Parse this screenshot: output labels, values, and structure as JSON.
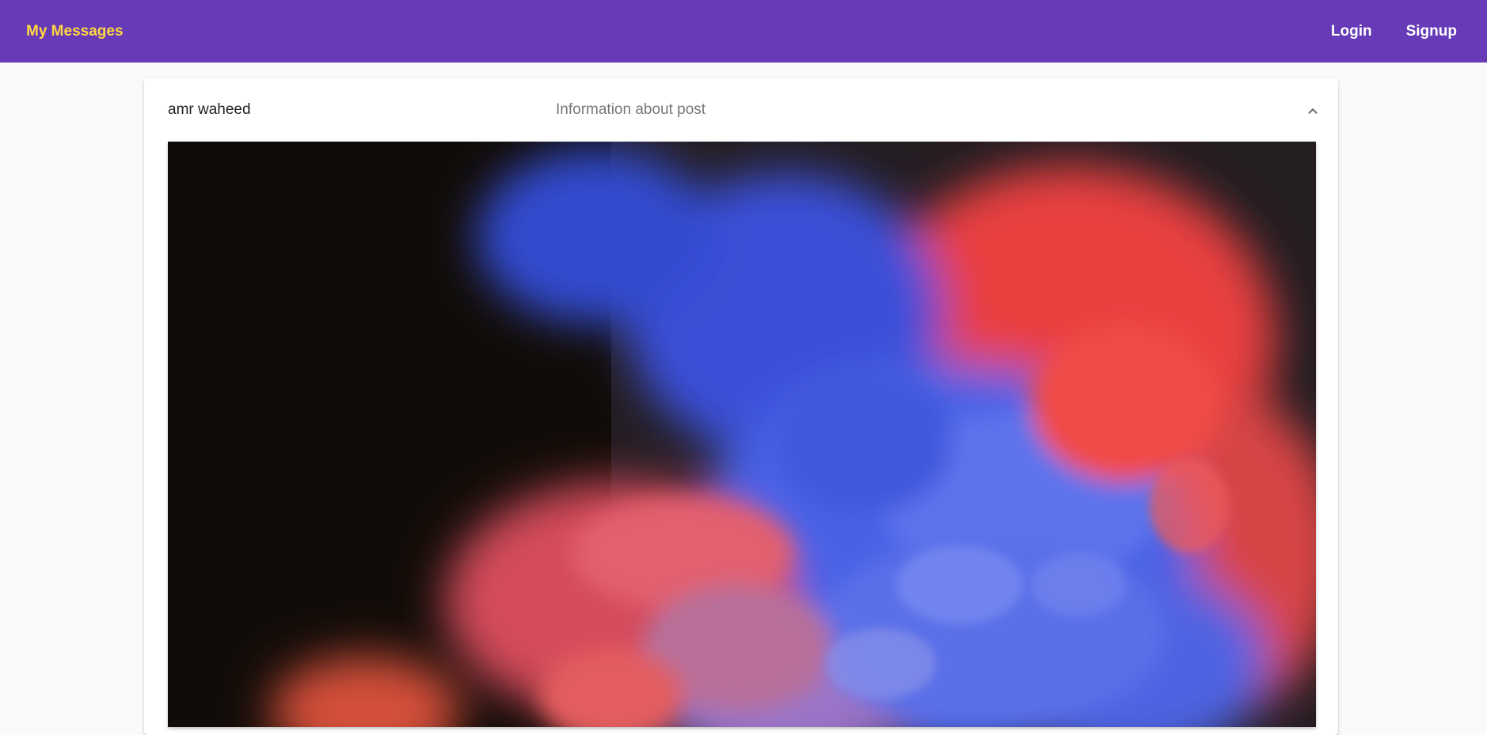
{
  "toolbar": {
    "brand": "My Messages",
    "login_label": "Login",
    "signup_label": "Signup",
    "background_color": "#673ab7",
    "brand_color": "#ffd740"
  },
  "post": {
    "author": "amr waheed",
    "description": "Information about post",
    "expanded": true,
    "toggle_icon": "chevron-up-icon",
    "image_subject": "colorful ink smoke (blue, red, pink) on dark background"
  }
}
